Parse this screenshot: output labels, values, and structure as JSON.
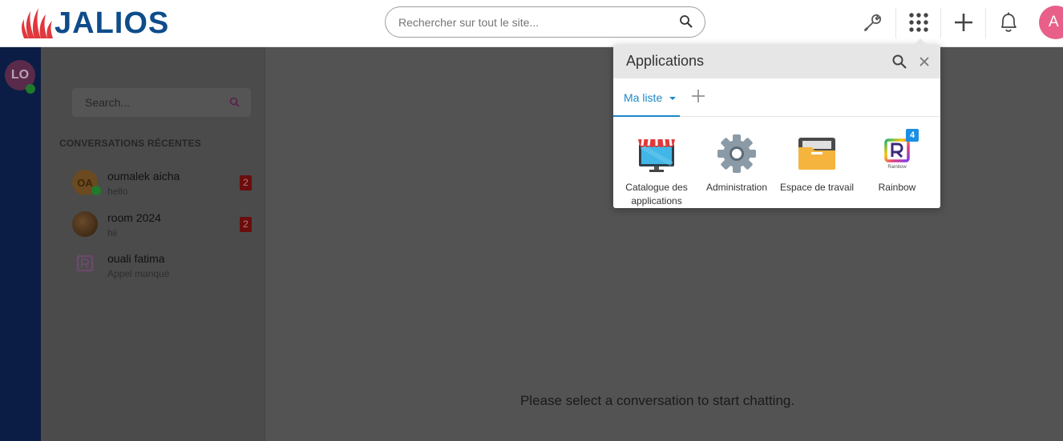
{
  "header": {
    "logo_text": "JALIOS",
    "search_placeholder": "Rechercher sur tout le site...",
    "avatar_initial": "A"
  },
  "sidebar_rail": {
    "user_initials": "LO"
  },
  "conversations": {
    "search_placeholder": "Search...",
    "section_title": "CONVERSATIONS RÉCENTES",
    "items": [
      {
        "initials": "OA",
        "name": "oumalek aicha",
        "last_message": "hello",
        "unread": "2"
      },
      {
        "initials": "",
        "name": "room 2024",
        "last_message": "hii",
        "unread": "2"
      },
      {
        "initials": "R",
        "name": "ouali fatima",
        "last_message": "Appel manqué",
        "unread": ""
      }
    ]
  },
  "main": {
    "empty_message": "Please select a conversation to start chatting."
  },
  "apps_popover": {
    "title": "Applications",
    "tab_label": "Ma liste",
    "apps": [
      {
        "label": "Catalogue des applications",
        "icon": "store-icon"
      },
      {
        "label": "Administration",
        "icon": "gear-icon"
      },
      {
        "label": "Espace de travail",
        "icon": "folder-icon"
      },
      {
        "label": "Rainbow",
        "icon": "rainbow-icon",
        "badge": "4"
      }
    ]
  },
  "colors": {
    "brand_red": "#e0383e",
    "brand_blue": "#0e4c8a",
    "accent_blue": "#1e88c7",
    "avatar_pink": "#e8608a"
  }
}
